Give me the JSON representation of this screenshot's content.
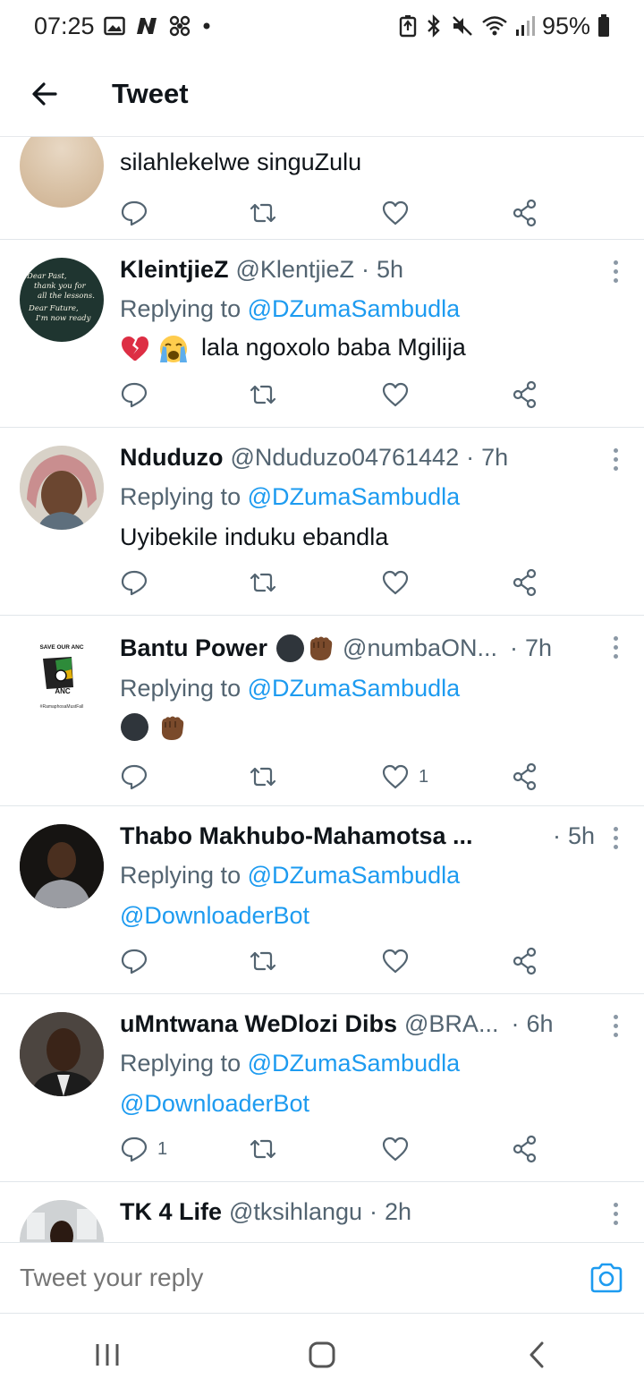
{
  "status_bar": {
    "time": "07:25",
    "battery": "95%",
    "left_icons": [
      "image-icon",
      "n-app-icon",
      "fan-app-icon",
      "dot-icon"
    ],
    "right_icons": [
      "battery-saver-icon",
      "bluetooth-icon",
      "mute-icon",
      "wifi-icon",
      "signal-icon",
      "battery-icon"
    ]
  },
  "header": {
    "title": "Tweet"
  },
  "tweets": [
    {
      "text": "silahlekelwe singuZulu",
      "actions": {
        "reply_count": "",
        "retweet_count": "",
        "like_count": ""
      }
    },
    {
      "name": "KleintjieZ",
      "handle": "@KlentjieZ",
      "sep": "·",
      "time": "5h",
      "replying_label": "Replying to",
      "replying_to": "@DZumaSambudla",
      "text": "lala ngoxolo baba Mgilija",
      "emojis": [
        "broken-heart",
        "crying-face"
      ],
      "avatar_text": [
        "Dear Past,",
        "thank you for",
        "all the lessons.",
        "Dear Future,",
        "I'm now ready"
      ],
      "actions": {
        "reply_count": "",
        "retweet_count": "",
        "like_count": ""
      }
    },
    {
      "name": "Nduduzo",
      "handle": "@Nduduzo04761442",
      "sep": "·",
      "time": "7h",
      "replying_label": "Replying to",
      "replying_to": "@DZumaSambudla",
      "text": "Uyibekile induku ebandla",
      "actions": {
        "reply_count": "",
        "retweet_count": "",
        "like_count": ""
      }
    },
    {
      "name": "Bantu Power",
      "handle": "@numbaON...",
      "sep": "·",
      "time": "7h",
      "replying_label": "Replying to",
      "replying_to": "@DZumaSambudla",
      "emojis": [
        "black-circle",
        "raised-fist-dark"
      ],
      "avatar_text": {
        "top": "SAVE OUR ANC",
        "badge": "ANC",
        "bottom": "#RamaphosaMustFall"
      },
      "actions": {
        "reply_count": "",
        "retweet_count": "",
        "like_count": "1"
      }
    },
    {
      "name": "Thabo Makhubo-Mahamotsa ...",
      "sep": "·",
      "time": "5h",
      "replying_label": "Replying to",
      "replying_to": "@DZumaSambudla",
      "text_mention": "@DownloaderBot",
      "actions": {
        "reply_count": "",
        "retweet_count": "",
        "like_count": ""
      }
    },
    {
      "name": "uMntwana WeDlozi Dibs",
      "handle": "@BRA...",
      "sep": "·",
      "time": "6h",
      "replying_label": "Replying to",
      "replying_to": "@DZumaSambudla",
      "text_mention": "@DownloaderBot",
      "actions": {
        "reply_count": "1",
        "retweet_count": "",
        "like_count": ""
      }
    },
    {
      "name": "TK 4 Life",
      "handle": "@tksihlangu",
      "sep": "·",
      "time": "2h"
    }
  ],
  "reply_bar": {
    "placeholder": "Tweet your reply"
  },
  "nav": {
    "buttons": [
      "recent-apps",
      "home",
      "back"
    ]
  },
  "colors": {
    "accent": "#1d9bf0",
    "text": "#0f1419",
    "muted": "#536471",
    "divider": "#e1e6ea"
  }
}
